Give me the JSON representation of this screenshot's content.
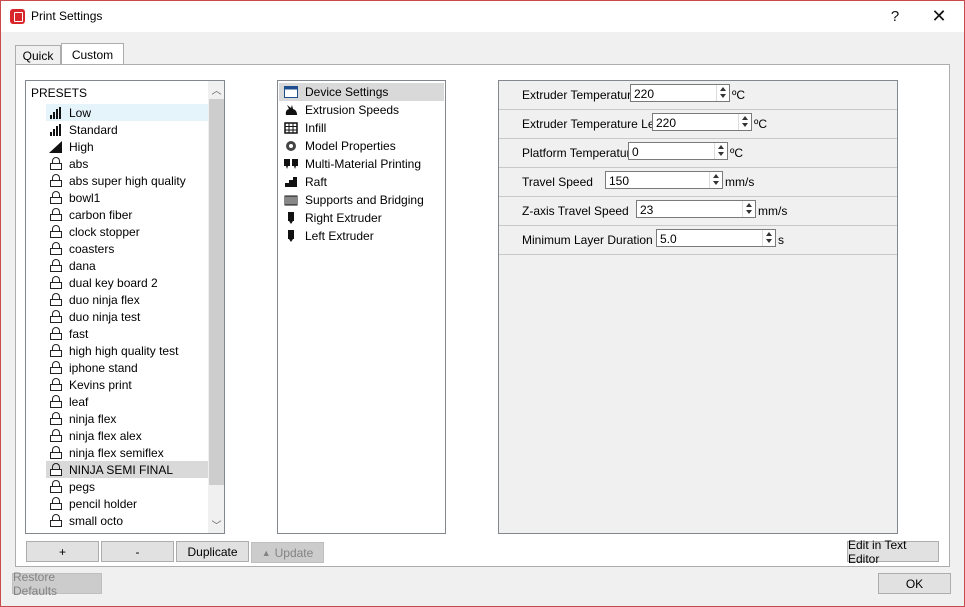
{
  "window": {
    "title": "Print Settings",
    "help_glyph": "?",
    "close_glyph": "✕"
  },
  "tabs": [
    {
      "label": "Quick",
      "selected": false
    },
    {
      "label": "Custom",
      "selected": true
    }
  ],
  "presets": {
    "header": "PRESETS",
    "items": [
      {
        "label": "Low",
        "icon": "signal-bars-icon"
      },
      {
        "label": "Standard",
        "icon": "signal-bars-icon"
      },
      {
        "label": "High",
        "icon": "triangle-icon"
      },
      {
        "label": "abs",
        "icon": "lock-icon"
      },
      {
        "label": "abs super high quality",
        "icon": "lock-icon"
      },
      {
        "label": "bowl1",
        "icon": "lock-icon"
      },
      {
        "label": "carbon fiber",
        "icon": "lock-icon"
      },
      {
        "label": "clock stopper",
        "icon": "lock-icon"
      },
      {
        "label": "coasters",
        "icon": "lock-icon"
      },
      {
        "label": "dana",
        "icon": "lock-icon"
      },
      {
        "label": "dual key board 2",
        "icon": "lock-icon"
      },
      {
        "label": "duo ninja flex",
        "icon": "lock-icon"
      },
      {
        "label": "duo ninja test",
        "icon": "lock-icon"
      },
      {
        "label": "fast",
        "icon": "lock-icon"
      },
      {
        "label": "high high quality test",
        "icon": "lock-icon"
      },
      {
        "label": "iphone stand",
        "icon": "lock-icon"
      },
      {
        "label": "Kevins print",
        "icon": "lock-icon"
      },
      {
        "label": "leaf",
        "icon": "lock-icon"
      },
      {
        "label": "ninja flex",
        "icon": "lock-icon"
      },
      {
        "label": "ninja flex alex",
        "icon": "lock-icon"
      },
      {
        "label": "ninja flex semiflex",
        "icon": "lock-icon"
      },
      {
        "label": "NINJA SEMI FINAL",
        "icon": "lock-icon"
      },
      {
        "label": "pegs",
        "icon": "lock-icon"
      },
      {
        "label": "pencil holder",
        "icon": "lock-icon"
      },
      {
        "label": "small octo",
        "icon": "lock-icon"
      }
    ],
    "hovered_index": 0,
    "selected_index": 21
  },
  "preset_buttons": {
    "add": "+",
    "remove": "-",
    "duplicate": "Duplicate",
    "update": "Update"
  },
  "categories": {
    "items": [
      {
        "label": "Device Settings",
        "icon": "window-icon"
      },
      {
        "label": "Extrusion Speeds",
        "icon": "rabbit-icon"
      },
      {
        "label": "Infill",
        "icon": "grid-icon"
      },
      {
        "label": "Model Properties",
        "icon": "gear-icon"
      },
      {
        "label": "Multi-Material Printing",
        "icon": "dual-extruder-icon"
      },
      {
        "label": "Raft",
        "icon": "stairs-icon"
      },
      {
        "label": "Supports and Bridging",
        "icon": "cylinder-icon"
      },
      {
        "label": "Right Extruder",
        "icon": "extruder-icon"
      },
      {
        "label": "Left Extruder",
        "icon": "extruder-icon"
      }
    ],
    "selected_index": 0
  },
  "settings": [
    {
      "label": "Extruder Temperature",
      "value": "220",
      "unit": "ºC"
    },
    {
      "label": "Extruder Temperature Left",
      "value": "220",
      "unit": "ºC"
    },
    {
      "label": "Platform Temperature",
      "value": "0",
      "unit": "ºC"
    },
    {
      "label": "Travel Speed",
      "value": "150",
      "unit": "mm/s"
    },
    {
      "label": "Z-axis Travel Speed",
      "value": "23",
      "unit": "mm/s"
    },
    {
      "label": "Minimum Layer Duration",
      "value": "5.0",
      "unit": "s"
    }
  ],
  "footer": {
    "edit_text": "Edit in Text Editor",
    "restore": "Restore Defaults",
    "ok": "OK"
  }
}
